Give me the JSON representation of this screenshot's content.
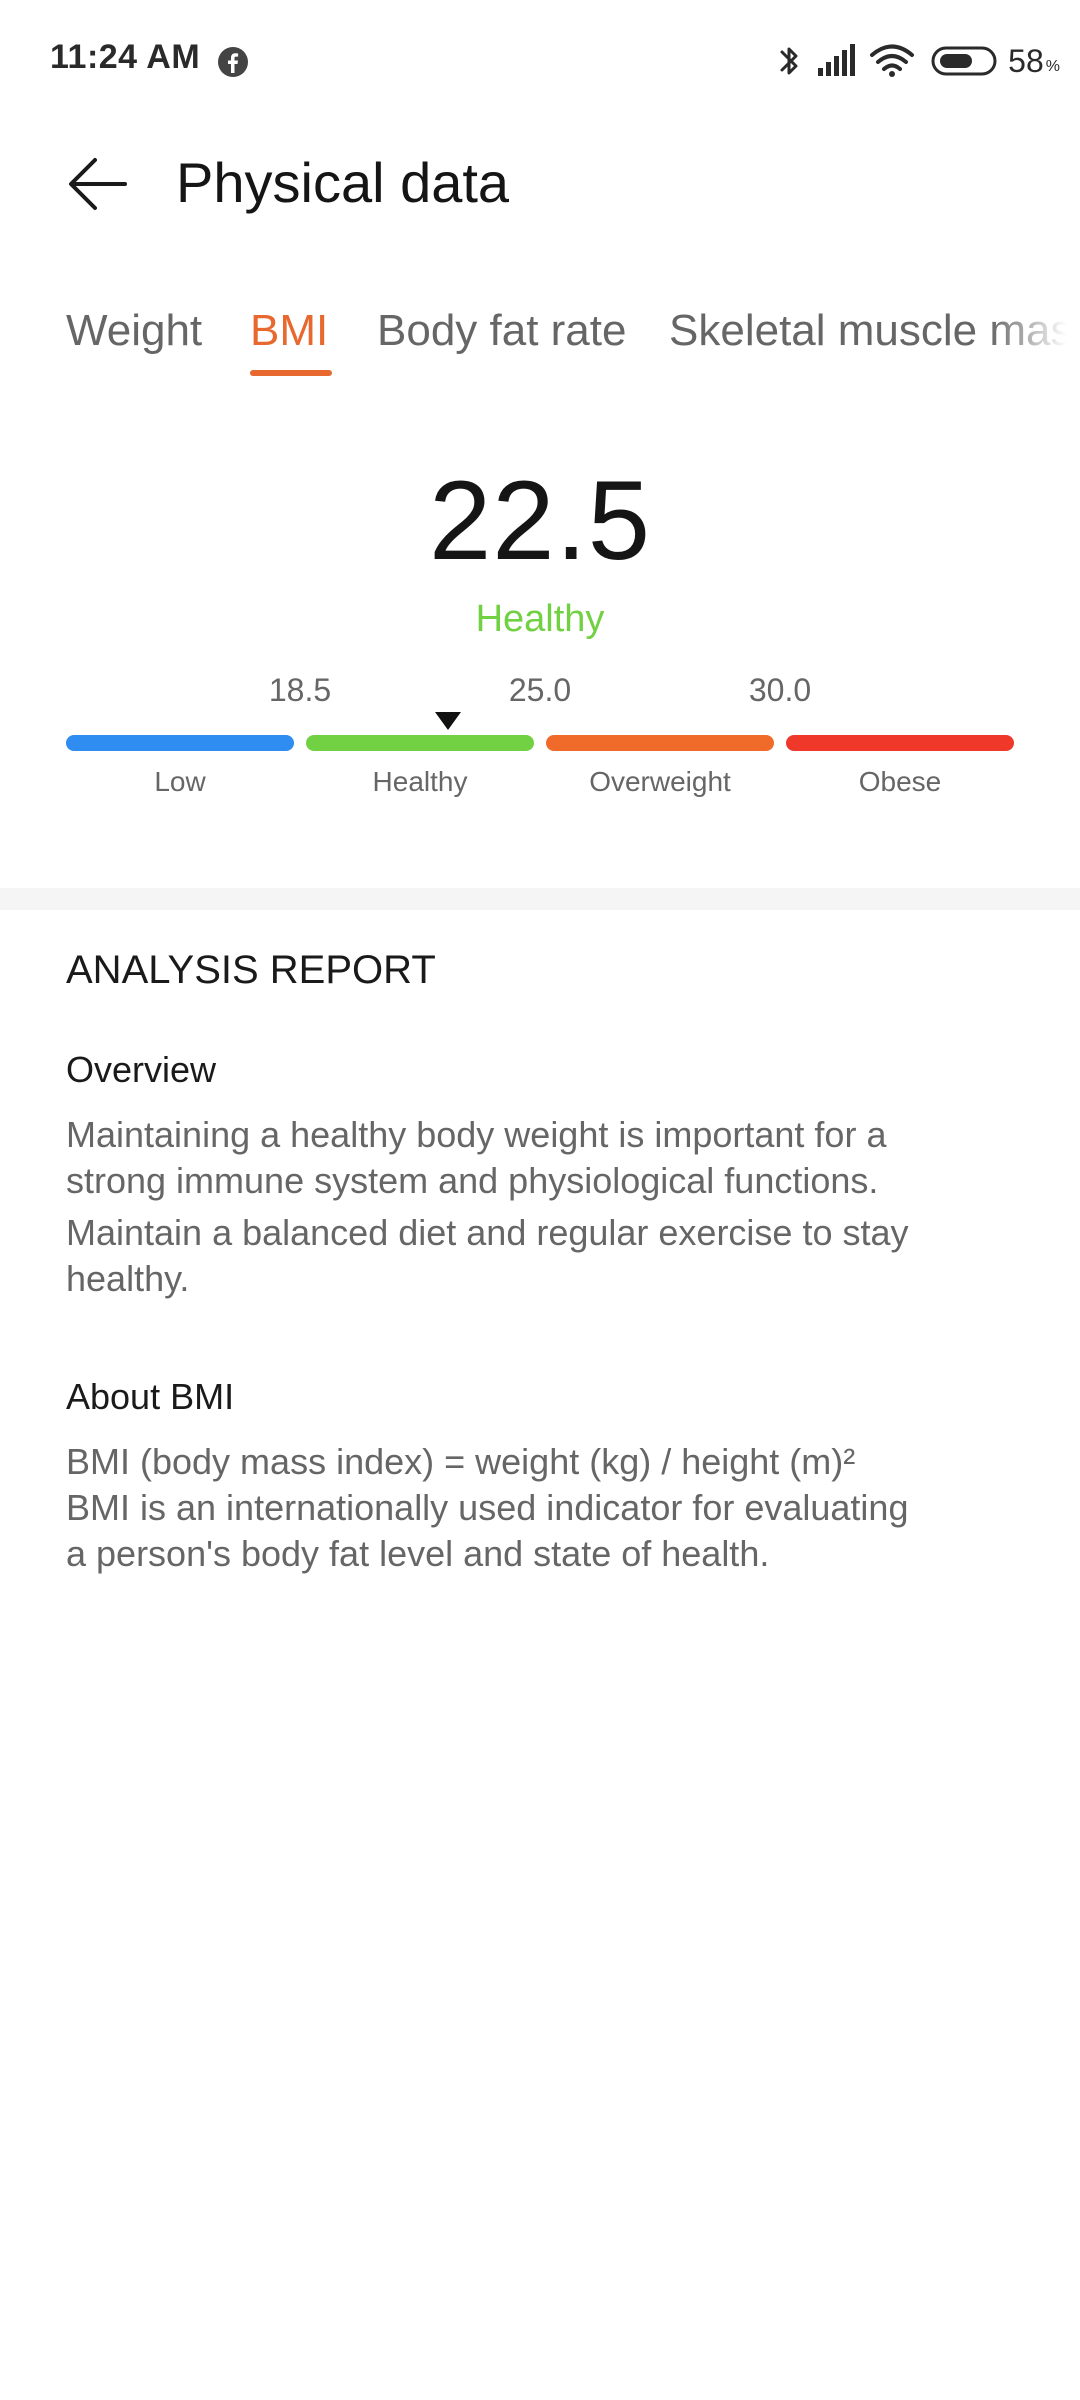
{
  "status_bar": {
    "time": "11:24 AM",
    "battery_value": "58",
    "battery_unit": "%",
    "icons": [
      "facebook-icon",
      "bluetooth-icon",
      "signal-icon",
      "wifi-icon",
      "battery-icon"
    ]
  },
  "header": {
    "title": "Physical data",
    "back_icon": "arrow-left-icon"
  },
  "tabs": [
    {
      "label": "Weight",
      "active": false
    },
    {
      "label": "BMI",
      "active": true
    },
    {
      "label": "Body fat rate",
      "active": false
    },
    {
      "label": "Skeletal muscle mas",
      "active": false
    }
  ],
  "bmi": {
    "value": "22.5",
    "status": "Healthy",
    "scale": {
      "thresholds": [
        "18.5",
        "25.0",
        "30.0"
      ],
      "marker_value": 22.5,
      "segments": [
        {
          "label": "Low",
          "color": "#2f8cf0"
        },
        {
          "label": "Healthy",
          "color": "#71d142"
        },
        {
          "label": "Overweight",
          "color": "#f06b2a"
        },
        {
          "label": "Obese",
          "color": "#f0382a"
        }
      ]
    }
  },
  "report": {
    "heading": "ANALYSIS REPORT",
    "overview": {
      "title": "Overview",
      "lines": [
        "Maintaining a healthy body weight is important for a",
        "strong immune system and physiological functions.",
        "Maintain a balanced diet and regular exercise to stay",
        "healthy."
      ]
    },
    "about": {
      "title": "About BMI",
      "lines": [
        "BMI (body mass index) = weight (kg) / height (m)²",
        "BMI is an internationally used indicator for evaluating",
        "a person's body fat level and state of health."
      ]
    }
  },
  "colors": {
    "accent": "#e8692f",
    "healthy": "#71d142",
    "text_secondary": "#666666"
  }
}
